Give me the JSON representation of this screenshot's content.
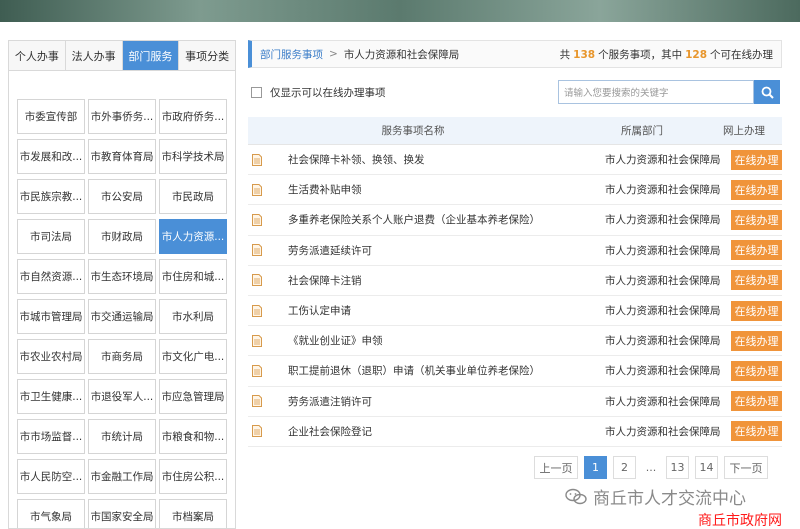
{
  "tabs": [
    {
      "label": "个人办事",
      "active": false
    },
    {
      "label": "法人办事",
      "active": false
    },
    {
      "label": "部门服务",
      "active": true
    },
    {
      "label": "事项分类",
      "active": false
    }
  ],
  "departments": [
    {
      "label": "市委宣传部",
      "active": false
    },
    {
      "label": "市外事侨务...",
      "active": false
    },
    {
      "label": "市政府侨务...",
      "active": false
    },
    {
      "label": "市发展和改...",
      "active": false
    },
    {
      "label": "市教育体育局",
      "active": false
    },
    {
      "label": "市科学技术局",
      "active": false
    },
    {
      "label": "市民族宗教...",
      "active": false
    },
    {
      "label": "市公安局",
      "active": false
    },
    {
      "label": "市民政局",
      "active": false
    },
    {
      "label": "市司法局",
      "active": false
    },
    {
      "label": "市财政局",
      "active": false
    },
    {
      "label": "市人力资源...",
      "active": true
    },
    {
      "label": "市自然资源...",
      "active": false
    },
    {
      "label": "市生态环境局",
      "active": false
    },
    {
      "label": "市住房和城...",
      "active": false
    },
    {
      "label": "市城市管理局",
      "active": false
    },
    {
      "label": "市交通运输局",
      "active": false
    },
    {
      "label": "市水利局",
      "active": false
    },
    {
      "label": "市农业农村局",
      "active": false
    },
    {
      "label": "市商务局",
      "active": false
    },
    {
      "label": "市文化广电...",
      "active": false
    },
    {
      "label": "市卫生健康...",
      "active": false
    },
    {
      "label": "市退役军人...",
      "active": false
    },
    {
      "label": "市应急管理局",
      "active": false
    },
    {
      "label": "市市场监督...",
      "active": false
    },
    {
      "label": "市统计局",
      "active": false
    },
    {
      "label": "市粮食和物...",
      "active": false
    },
    {
      "label": "市人民防空...",
      "active": false
    },
    {
      "label": "市金融工作局",
      "active": false
    },
    {
      "label": "市住房公积...",
      "active": false
    },
    {
      "label": "市气象局",
      "active": false
    },
    {
      "label": "市国家安全局",
      "active": false
    },
    {
      "label": "市档案局",
      "active": false
    }
  ],
  "breadcrumb": {
    "root": "部门服务事项",
    "separator": ">",
    "current": "市人力资源和社会保障局"
  },
  "stats": {
    "prefix": "共",
    "total": "138",
    "middle": "个服务事项，其中",
    "online": "128",
    "suffix": "个可在线办理"
  },
  "filter": {
    "checkbox_label": "仅显示可以在线办理事项",
    "checked": false,
    "search_placeholder": "请输入您要搜索的关键字"
  },
  "table": {
    "headers": {
      "name": "服务事项名称",
      "dept": "所属部门",
      "online": "网上办理"
    },
    "rows": [
      {
        "name": "社会保障卡补领、换领、换发",
        "dept": "市人力资源和社会保障局",
        "action": "在线办理"
      },
      {
        "name": "生活费补贴申领",
        "dept": "市人力资源和社会保障局",
        "action": "在线办理"
      },
      {
        "name": "多重养老保险关系个人账户退费（企业基本养老保险）",
        "dept": "市人力资源和社会保障局",
        "action": "在线办理"
      },
      {
        "name": "劳务派遣延续许可",
        "dept": "市人力资源和社会保障局",
        "action": "在线办理"
      },
      {
        "name": "社会保障卡注销",
        "dept": "市人力资源和社会保障局",
        "action": "在线办理"
      },
      {
        "name": "工伤认定申请",
        "dept": "市人力资源和社会保障局",
        "action": "在线办理"
      },
      {
        "name": "《就业创业证》申领",
        "dept": "市人力资源和社会保障局",
        "action": "在线办理"
      },
      {
        "name": "职工提前退休（退职）申请（机关事业单位养老保险）",
        "dept": "市人力资源和社会保障局",
        "action": "在线办理"
      },
      {
        "name": "劳务派遣注销许可",
        "dept": "市人力资源和社会保障局",
        "action": "在线办理"
      },
      {
        "name": "企业社会保险登记",
        "dept": "市人力资源和社会保障局",
        "action": "在线办理"
      }
    ]
  },
  "pagination": {
    "prev": "上一页",
    "pages": [
      "1",
      "2",
      "...",
      "13",
      "14"
    ],
    "current": "1",
    "next": "下一页"
  },
  "watermarks": {
    "wechat": "商丘市人才交流中心",
    "site": "商丘市政府网"
  },
  "colors": {
    "accent": "#4a8fd7",
    "highlight": "#e8962c",
    "button": "#f0943a",
    "watermark_red": "#ff1a1a"
  },
  "icons": {
    "row": "document-icon",
    "search": "search-icon",
    "watermark": "wechat-icon"
  }
}
